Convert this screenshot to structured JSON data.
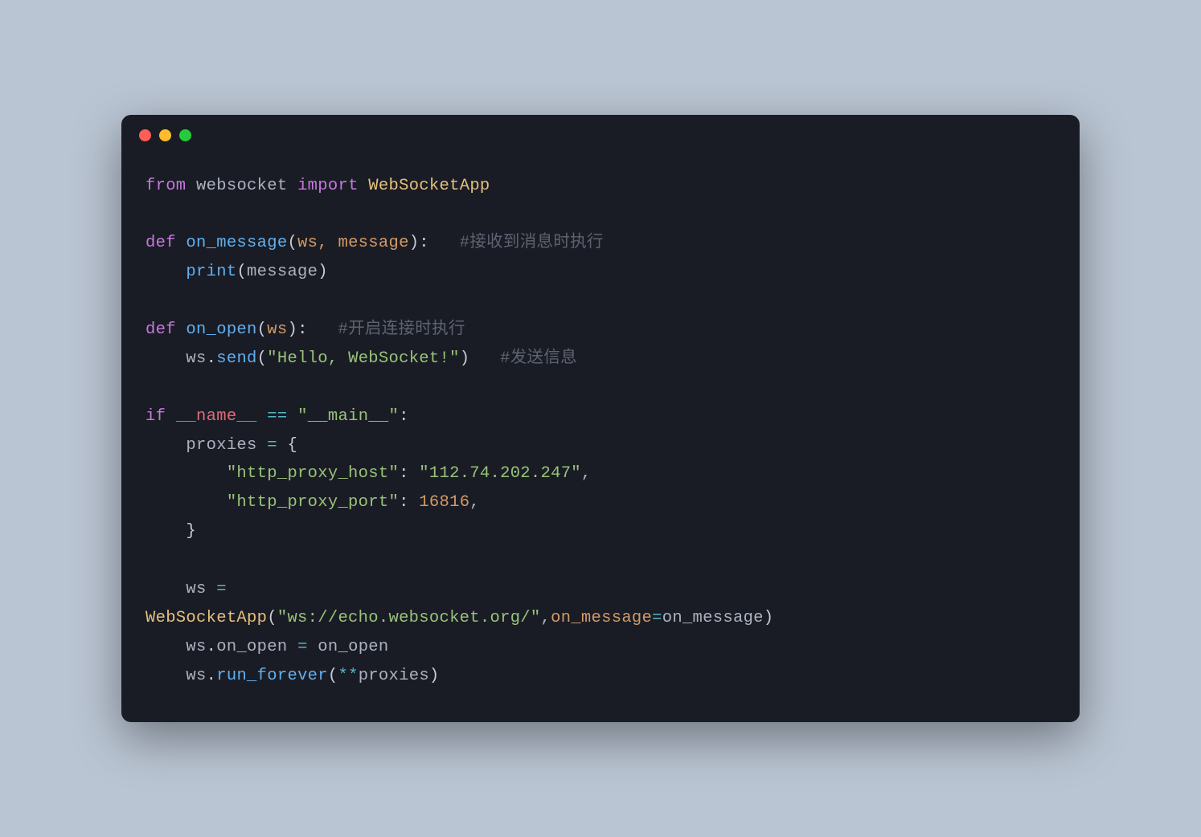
{
  "window": {
    "traffic_lights": {
      "red": "close",
      "yellow": "minimize",
      "green": "maximize"
    }
  },
  "code": {
    "line1": {
      "from": "from",
      "module": "websocket",
      "import": "import",
      "class": "WebSocketApp"
    },
    "line3": {
      "def": "def",
      "name": "on_message",
      "params": "ws, message",
      "comment": "#接收到消息时执行"
    },
    "line4": {
      "func": "print",
      "arg": "message"
    },
    "line6": {
      "def": "def",
      "name": "on_open",
      "params": "ws",
      "comment": "#开启连接时执行"
    },
    "line7": {
      "obj": "ws",
      "method": "send",
      "arg": "\"Hello, WebSocket!\"",
      "comment": "#发送信息"
    },
    "line9": {
      "if": "if",
      "name": "__name__",
      "op": "==",
      "main": "\"__main__\""
    },
    "line10": {
      "var": "proxies",
      "op": "=",
      "brace": "{"
    },
    "line11": {
      "key": "\"http_proxy_host\"",
      "val": "\"112.74.202.247\""
    },
    "line12": {
      "key": "\"http_proxy_port\"",
      "val": "16816"
    },
    "line13": {
      "brace": "}"
    },
    "line15": {
      "var": "ws",
      "op": "="
    },
    "line16": {
      "class": "WebSocketApp",
      "url": "\"ws://echo.websocket.org/\"",
      "kwarg": "on_message",
      "kwval": "on_message"
    },
    "line17": {
      "obj": "ws",
      "attr": "on_open",
      "op": "=",
      "val": "on_open"
    },
    "line18": {
      "obj": "ws",
      "method": "run_forever",
      "star": "**",
      "arg": "proxies"
    }
  }
}
